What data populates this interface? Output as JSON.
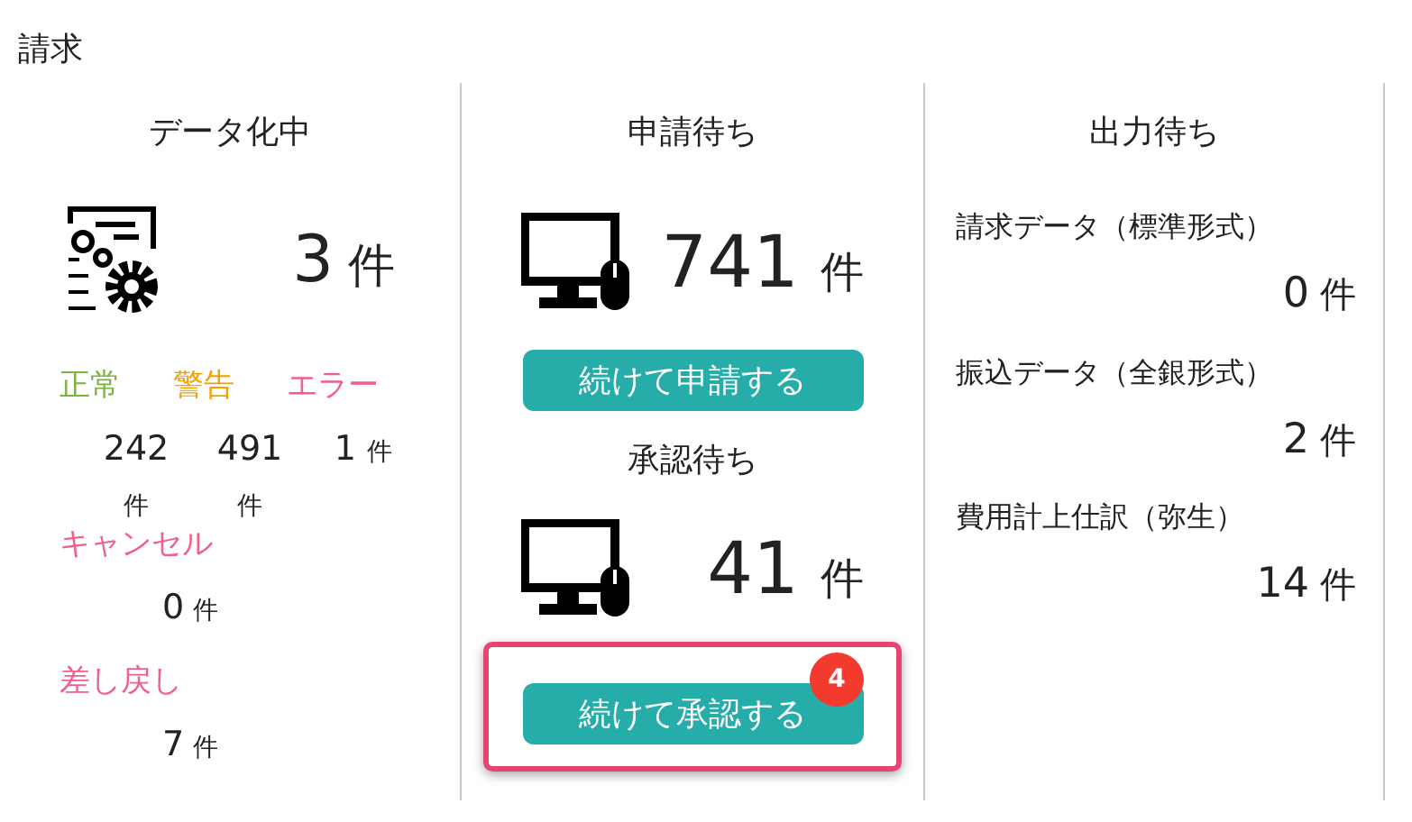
{
  "title": "請求",
  "digitizing": {
    "heading": "データ化中",
    "count": "3",
    "unit": "件",
    "statuses": [
      {
        "label": "正常",
        "color": "#7cb342",
        "count": "242",
        "unit": "件"
      },
      {
        "label": "警告",
        "color": "#f5a000",
        "count": "491",
        "unit": "件"
      },
      {
        "label": "エラー",
        "color": "#f0608a",
        "count": "1",
        "unit": "件"
      }
    ],
    "others": [
      {
        "label": "キャンセル",
        "color": "#f0608a",
        "count": "0",
        "unit": "件"
      },
      {
        "label": "差し戻し",
        "color": "#f0608a",
        "count": "7",
        "unit": "件"
      }
    ]
  },
  "application_pending": {
    "heading": "申請待ち",
    "count": "741",
    "unit": "件",
    "button": "続けて申請する",
    "highlighted": false
  },
  "approval_pending": {
    "heading": "承認待ち",
    "count": "41",
    "unit": "件",
    "button": "続けて承認する",
    "badge": "4",
    "highlighted": true
  },
  "output_pending": {
    "heading": "出力待ち",
    "items": [
      {
        "label": "請求データ（標準形式）",
        "count": "0",
        "unit": "件"
      },
      {
        "label": "振込データ（全銀形式）",
        "count": "2",
        "unit": "件"
      },
      {
        "label": "費用計上仕訳（弥生）",
        "count": "14",
        "unit": "件"
      }
    ]
  }
}
